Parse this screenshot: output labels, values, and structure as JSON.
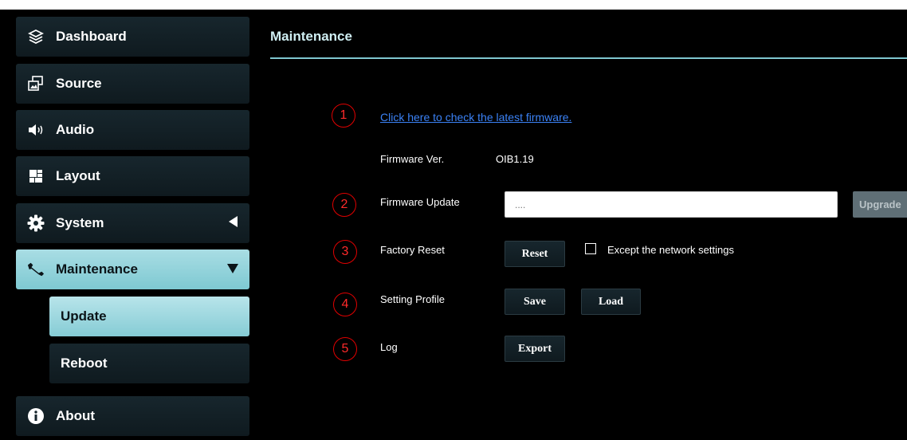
{
  "sidebar": {
    "items": [
      {
        "label": "Dashboard",
        "icon": "layers-icon"
      },
      {
        "label": "Source",
        "icon": "source-icon"
      },
      {
        "label": "Audio",
        "icon": "speaker-icon"
      },
      {
        "label": "Layout",
        "icon": "layout-grid-icon"
      },
      {
        "label": "System",
        "icon": "gear-icon",
        "caret": "collapsed"
      },
      {
        "label": "Maintenance",
        "icon": "wrench-icon",
        "caret": "expanded"
      },
      {
        "label": "About",
        "icon": "info-icon"
      }
    ],
    "sub_items": [
      {
        "label": "Update",
        "active": true
      },
      {
        "label": "Reboot",
        "active": false
      }
    ]
  },
  "main": {
    "title": "Maintenance",
    "steps": [
      "1",
      "2",
      "3",
      "4",
      "5"
    ],
    "firmware_link": "Click here to check the latest firmware.",
    "firmware_ver_label": "Firmware Ver.",
    "firmware_ver_value": "OIB1.19",
    "firmware_update_label": "Firmware Update",
    "firmware_file_placeholder": "....",
    "upgrade_button": "Upgrade",
    "factory_reset_label": "Factory Reset",
    "reset_button": "Reset",
    "except_network_label": "Except the network settings",
    "except_network_checked": false,
    "setting_profile_label": "Setting Profile",
    "save_button": "Save",
    "load_button": "Load",
    "log_label": "Log",
    "export_button": "Export"
  },
  "colors": {
    "background": "#000000",
    "sidebar_item": "#17262d",
    "sidebar_active": "#a9dde4",
    "title": "#cfeef2",
    "accent_rule": "#7fc7cf",
    "link": "#3b82f6",
    "step_circle": "#e10000"
  }
}
